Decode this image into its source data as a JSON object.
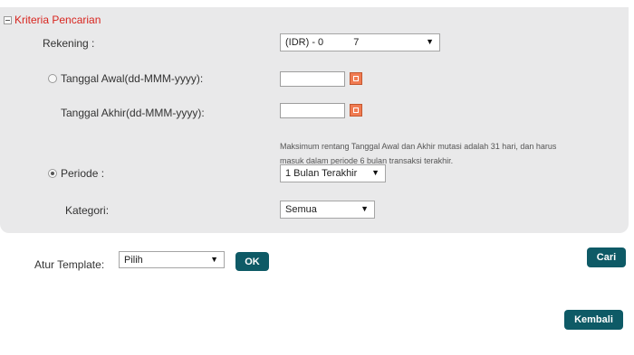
{
  "panel": {
    "title": "Kriteria Pencarian",
    "rekening_label": "Rekening :",
    "rekening_value": "(IDR) - 0               7",
    "tanggal_awal_label": "Tanggal Awal(dd-MMM-yyyy):",
    "tanggal_akhir_label": "Tanggal Akhir(dd-MMM-yyyy):",
    "tanggal_awal_value": "",
    "tanggal_akhir_value": "",
    "note_line1": "Maksimum rentang Tanggal Awal dan Akhir mutasi adalah 31 hari, dan harus",
    "note_line2": "masuk dalam periode 6 bulan transaksi terakhir.",
    "periode_label": "Periode :",
    "periode_value": "1 Bulan Terakhir",
    "kategori_label": "Kategori:",
    "kategori_value": "Semua"
  },
  "template": {
    "label": "Atur Template:",
    "value": "Pilih",
    "ok_label": "OK"
  },
  "buttons": {
    "cari_label": "Cari",
    "kembali_label": "Kembali"
  },
  "colors": {
    "panel_bg": "#e9e9ea",
    "title_red": "#d8251f",
    "button_teal": "#0e5a66",
    "calendar_orange": "#f07b52"
  }
}
